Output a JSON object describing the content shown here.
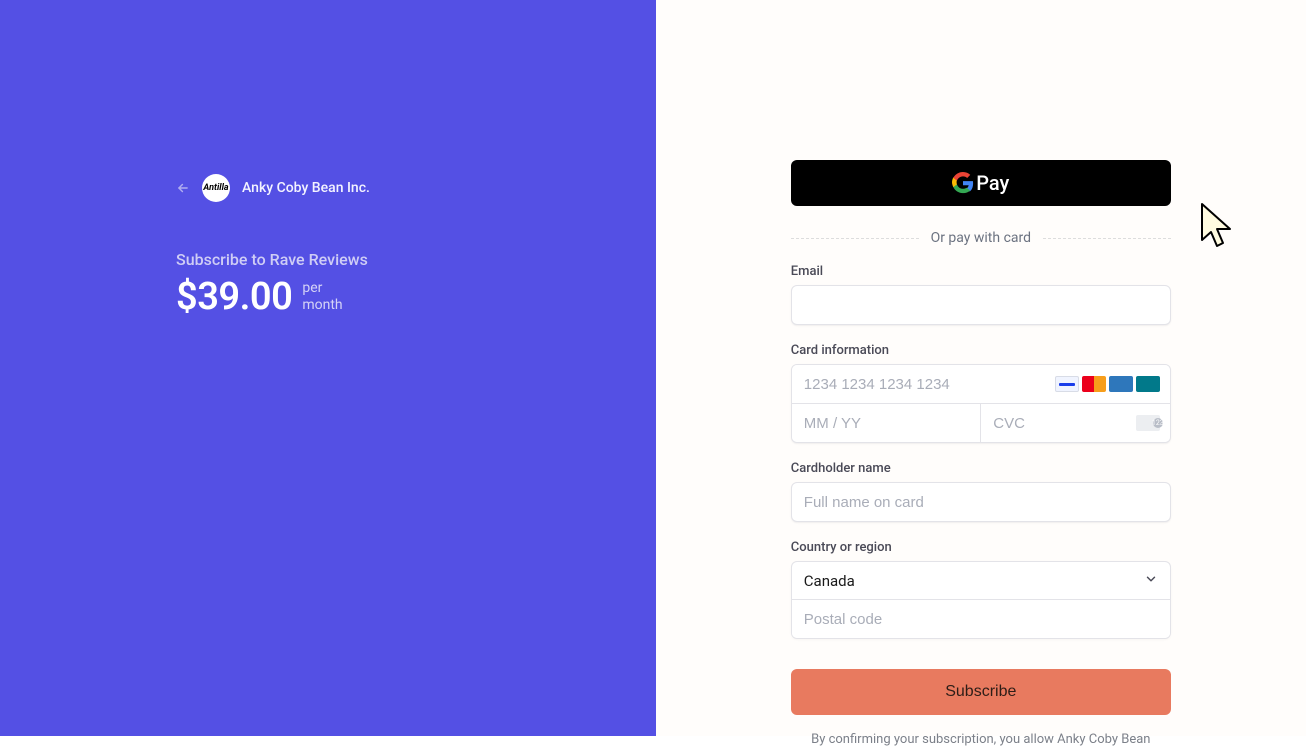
{
  "merchant": {
    "name": "Anky Coby Bean Inc.",
    "logo_text": "Antilla"
  },
  "product": {
    "title": "Subscribe to Rave Reviews",
    "price": "$39.00",
    "period_line1": "per",
    "period_line2": "month"
  },
  "payment": {
    "gpay_label": "Pay",
    "divider_text": "Or pay with card",
    "email_label": "Email",
    "card_label": "Card information",
    "card_number_placeholder": "1234 1234 1234 1234",
    "expiry_placeholder": "MM / YY",
    "cvc_placeholder": "CVC",
    "cardholder_label": "Cardholder name",
    "cardholder_placeholder": "Full name on card",
    "country_label": "Country or region",
    "country_value": "Canada",
    "postal_placeholder": "Postal code",
    "submit_label": "Subscribe",
    "legal_text": "By confirming your subscription, you allow Anky Coby Bean"
  }
}
